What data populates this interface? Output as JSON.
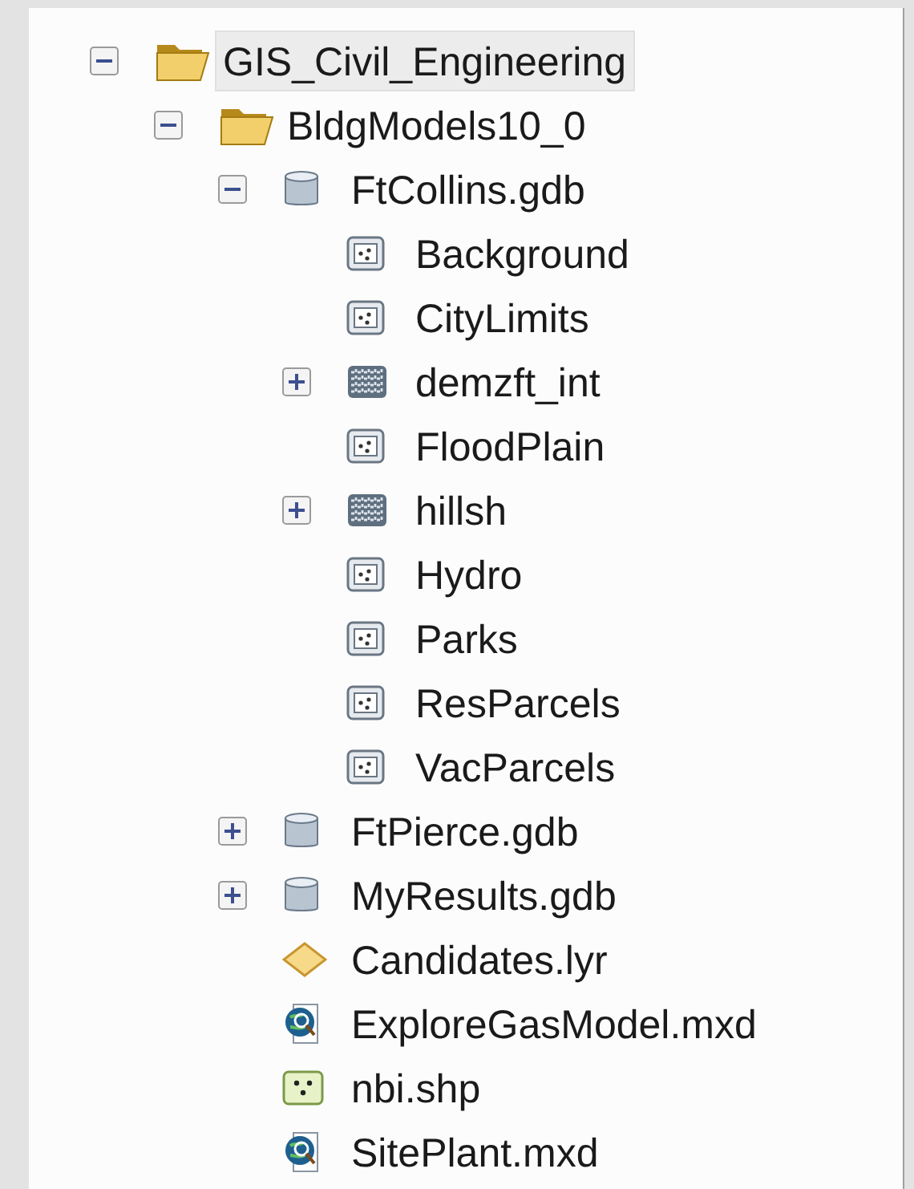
{
  "tree": [
    {
      "label": "GIS_Civil_Engineering",
      "kind": "folder",
      "expanded": true,
      "selected": true,
      "children": [
        {
          "label": "BldgModels10_0",
          "kind": "folder",
          "expanded": true,
          "selected": false,
          "children": [
            {
              "label": "FtCollins.gdb",
              "kind": "geodatabase",
              "expanded": true,
              "selected": false,
              "children": [
                {
                  "label": "Background",
                  "kind": "polygon",
                  "selected": false
                },
                {
                  "label": "CityLimits",
                  "kind": "polygon",
                  "selected": false
                },
                {
                  "label": "demzft_int",
                  "kind": "raster",
                  "expanded": false,
                  "selected": false
                },
                {
                  "label": "FloodPlain",
                  "kind": "polygon",
                  "selected": false
                },
                {
                  "label": "hillsh",
                  "kind": "raster",
                  "expanded": false,
                  "selected": false
                },
                {
                  "label": "Hydro",
                  "kind": "polygon",
                  "selected": false
                },
                {
                  "label": "Parks",
                  "kind": "polygon",
                  "selected": false
                },
                {
                  "label": "ResParcels",
                  "kind": "polygon",
                  "selected": false
                },
                {
                  "label": "VacParcels",
                  "kind": "polygon",
                  "selected": false
                }
              ]
            },
            {
              "label": "FtPierce.gdb",
              "kind": "geodatabase",
              "expanded": false,
              "selected": false
            },
            {
              "label": "MyResults.gdb",
              "kind": "geodatabase",
              "expanded": false,
              "selected": false
            },
            {
              "label": "Candidates.lyr",
              "kind": "layer",
              "selected": false
            },
            {
              "label": "ExploreGasModel.mxd",
              "kind": "map",
              "selected": false
            },
            {
              "label": "nbi.shp",
              "kind": "shapefile",
              "selected": false
            },
            {
              "label": "SitePlant.mxd",
              "kind": "map",
              "selected": false
            }
          ]
        }
      ]
    }
  ]
}
